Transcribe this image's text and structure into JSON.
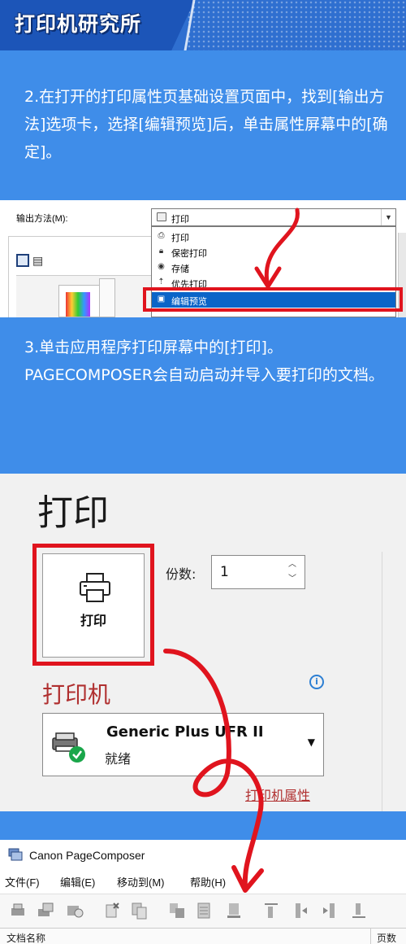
{
  "header": {
    "title": "打印机研究所"
  },
  "step2": {
    "text": "2.在打开的打印属性页基础设置页面中，找到[输出方法]选项卡，选择[编辑预览]后，单击属性屏幕中的[确定]。"
  },
  "dialog": {
    "output_label": "输出方法(M):",
    "selected_value": "打印",
    "options": [
      {
        "label": "打印",
        "icon": "printer-icon"
      },
      {
        "label": "保密打印",
        "icon": "lock-icon"
      },
      {
        "label": "存储",
        "icon": "store-icon"
      },
      {
        "label": "优先打印",
        "icon": "priority-icon"
      },
      {
        "label": "编辑预览",
        "icon": "edit-preview-icon",
        "selected": true
      }
    ]
  },
  "step3": {
    "text": "3.单击应用程序打印屏幕中的[打印]。PAGECOMPOSER会自动启动并导入要打印的文档。"
  },
  "print_screen": {
    "title": "打印",
    "print_button_label": "打印",
    "copies_label": "份数:",
    "copies_value": "1",
    "printer_header": "打印机",
    "printer_name": "Generic Plus UFR II",
    "printer_status": "就绪",
    "printer_props_link": "打印机属性"
  },
  "composer": {
    "app_title": "Canon PageComposer",
    "menus": [
      "文件(F)",
      "编辑(E)",
      "移动到(M)",
      "帮助(H)"
    ],
    "columns": [
      "文档名称",
      "页数"
    ]
  },
  "colors": {
    "accent_blue": "#3f8de9",
    "header_blue": "#1c55b8",
    "highlight_red": "#e0141e"
  }
}
